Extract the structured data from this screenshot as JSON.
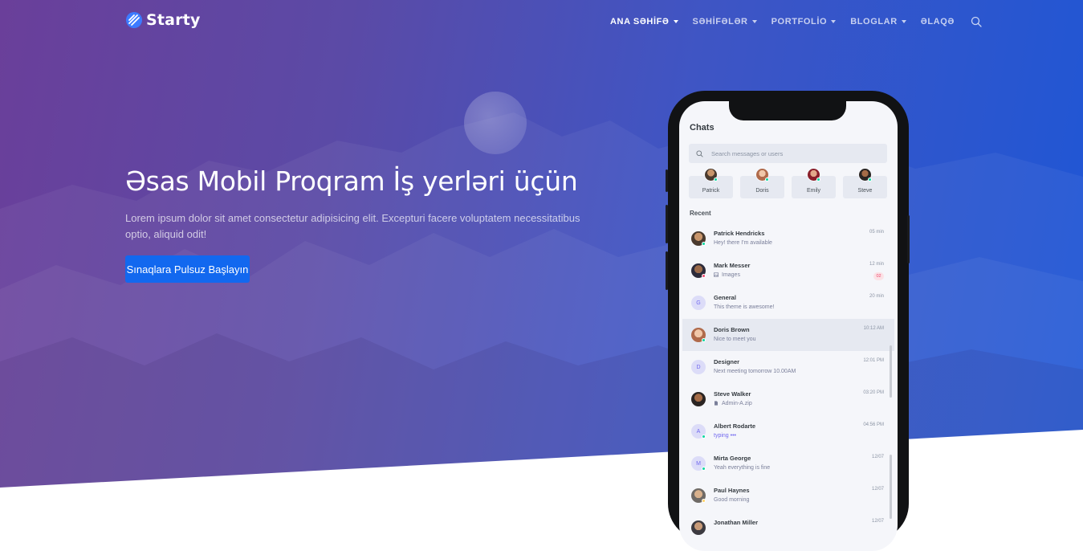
{
  "brand": {
    "name": "Starty",
    "accent": "#3d7bff"
  },
  "nav": {
    "items": [
      {
        "label": "ANA SƏHİFƏ",
        "caret": true,
        "active": true
      },
      {
        "label": "SƏHİFƏLƏR",
        "caret": true
      },
      {
        "label": "PORTFOLİO",
        "caret": true
      },
      {
        "label": "BLOGLAR",
        "caret": true
      },
      {
        "label": "ƏLAQƏ",
        "caret": false
      }
    ],
    "search_icon": "search-icon"
  },
  "hero": {
    "headline": "Əsas Mobil Proqram İş yerləri üçün",
    "subtext": "Lorem ipsum dolor sit amet consectetur adipisicing elit. Excepturi facere voluptatem necessitatibus optio, aliquid odit!",
    "cta_label": "Sınaqlara Pulsuz Başlayın",
    "cta_color": "#1268ef"
  },
  "phone": {
    "title": "Chats",
    "search_placeholder": "Search messages or users",
    "favorites": [
      {
        "name": "Patrick"
      },
      {
        "name": "Doris"
      },
      {
        "name": "Emily"
      },
      {
        "name": "Steve"
      }
    ],
    "recent_label": "Recent",
    "chats": [
      {
        "name": "Patrick Hendricks",
        "message": "Hey! there I'm available",
        "time": "05 min",
        "avatar": "photo"
      },
      {
        "name": "Mark Messer",
        "message": "Images",
        "time": "12 min",
        "unread": "02",
        "avatar": "photo",
        "msg_icon": "image-icon"
      },
      {
        "name": "General",
        "message": "This theme is awesome!",
        "time": "20 min",
        "avatar": "G"
      },
      {
        "name": "Doris Brown",
        "message": "Nice to meet you",
        "time": "10:12 AM",
        "avatar": "photo",
        "active": true
      },
      {
        "name": "Designer",
        "message": "Next meeting tomorrow 10.00AM",
        "time": "12:01 PM",
        "avatar": "D"
      },
      {
        "name": "Steve Walker",
        "message": "Admin-A.zip",
        "time": "03:20 PM",
        "avatar": "photo",
        "msg_icon": "file-icon"
      },
      {
        "name": "Albert Rodarte",
        "message": "typing",
        "time": "04:56 PM",
        "avatar": "A",
        "typing": true
      },
      {
        "name": "Mirta George",
        "message": "Yeah everything is fine",
        "time": "12/07",
        "avatar": "M"
      },
      {
        "name": "Paul Haynes",
        "message": "Good morning",
        "time": "12/07",
        "avatar": "photo"
      },
      {
        "name": "Jonathan Miller",
        "message": "",
        "time": "12/07",
        "avatar": "photo"
      }
    ]
  }
}
